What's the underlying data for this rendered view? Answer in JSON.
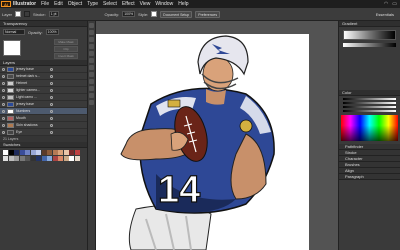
{
  "menubar": {
    "logo": "Ai",
    "items": [
      "Illustrator",
      "File",
      "Edit",
      "Object",
      "Type",
      "Select",
      "Effect",
      "View",
      "Window",
      "Help"
    ]
  },
  "controlbar": {
    "selection_label": "Layer",
    "stroke_label": "Stroke:",
    "stroke_value": "1 pt",
    "opacity_label": "Opacity:",
    "opacity_value": "100%",
    "style_label": "Style:",
    "doc_setup": "Document Setup",
    "preferences": "Preferences",
    "workspace": "Essentials"
  },
  "transparency": {
    "tab": "Transparency",
    "blend_mode": "Normal",
    "opacity_label": "Opacity:",
    "opacity_value": "100%",
    "make_mask": "Make Mask",
    "clip": "Clip",
    "invert_mask": "Invert Mask"
  },
  "layers": {
    "tab": "Layers",
    "items": [
      {
        "name": "jersey base",
        "color": "#2a4a9a",
        "selected": false
      },
      {
        "name": "helmet dark s...",
        "color": "#4a4a4a",
        "selected": false
      },
      {
        "name": "Helmet",
        "color": "#cccccc",
        "selected": false
      },
      {
        "name": "lighter cameo...",
        "color": "#d8d8d8",
        "selected": false
      },
      {
        "name": "Light camo ...",
        "color": "#bfbfbf",
        "selected": false
      },
      {
        "name": "jersey base",
        "color": "#2a4a9a",
        "selected": false
      },
      {
        "name": "Numbers",
        "color": "#ffffff",
        "selected": true
      },
      {
        "name": "Mouth",
        "color": "#b06060",
        "selected": false
      },
      {
        "name": "Skin shadows",
        "color": "#b07a50",
        "selected": false
      },
      {
        "name": "Eye",
        "color": "#444444",
        "selected": false
      }
    ],
    "footer": "21 Layers"
  },
  "swatches": {
    "tab": "Swatches",
    "colors": [
      "#ffffff",
      "#000000",
      "#1e2a5a",
      "#3b4e9a",
      "#6f82c4",
      "#9aa8d6",
      "#c5cfee",
      "#5a3a2a",
      "#8a5a3a",
      "#b57a55",
      "#d9a27a",
      "#eac5a8",
      "#7a2a2a",
      "#c04040",
      "#e0e0e0",
      "#bdbdbd",
      "#9a9a9a",
      "#787878",
      "#555555",
      "#333333",
      "#223366",
      "#4466aa",
      "#88aadd",
      "#aa4444",
      "#dd8866",
      "#ccaa88",
      "#ffffff",
      "#e8d8c8"
    ]
  },
  "rightpanel": {
    "gradient_tab": "Gradient",
    "color_tab": "Color",
    "collapsed": [
      "Pathfinder",
      "Stroke",
      "Character",
      "Brushes",
      "Align",
      "Paragraph"
    ]
  }
}
